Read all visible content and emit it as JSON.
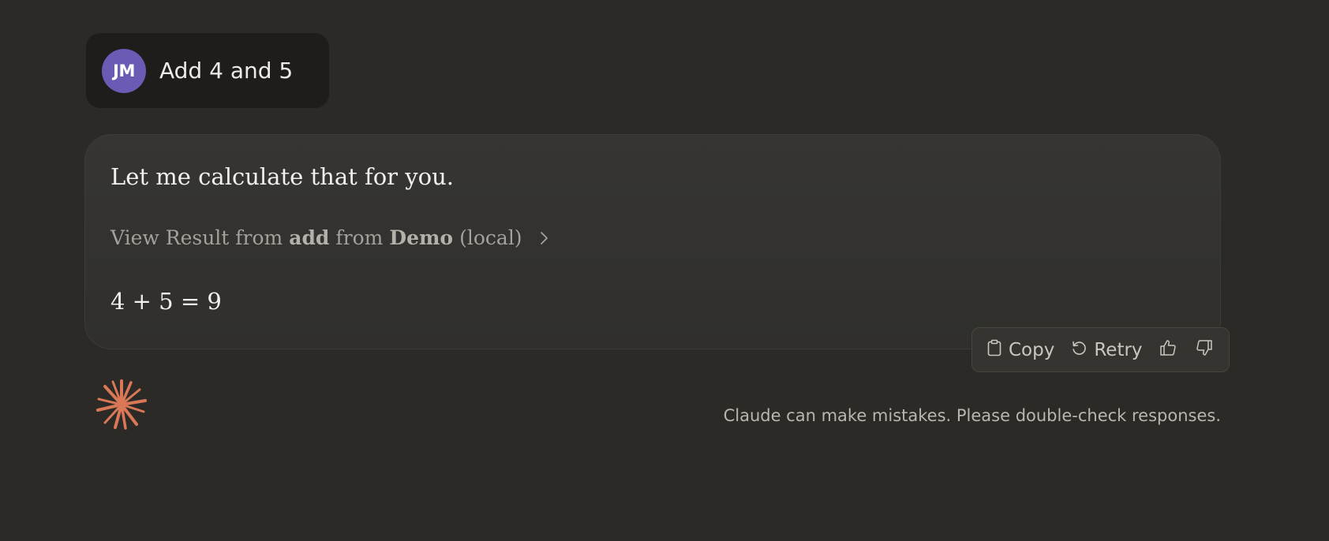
{
  "user_message": {
    "avatar_initials": "JM",
    "avatar_color": "#6b5bb5",
    "text": "Add 4 and 5"
  },
  "assistant_message": {
    "intro": "Let me calculate that for you.",
    "tool_call": {
      "prefix": "View Result from",
      "tool_name": "add",
      "middle": "from",
      "server_name": "Demo",
      "suffix": "(local)",
      "icon": "chevron-right-icon"
    },
    "result": "4 + 5 = 9"
  },
  "actions": {
    "copy_label": "Copy",
    "copy_icon": "clipboard-icon",
    "retry_label": "Retry",
    "retry_icon": "retry-icon",
    "thumbs_up_icon": "thumbs-up-icon",
    "thumbs_down_icon": "thumbs-down-icon"
  },
  "footer": {
    "logo_icon": "claude-spark-icon",
    "logo_color": "#d97757",
    "disclaimer": "Claude can make mistakes. Please double-check responses."
  }
}
